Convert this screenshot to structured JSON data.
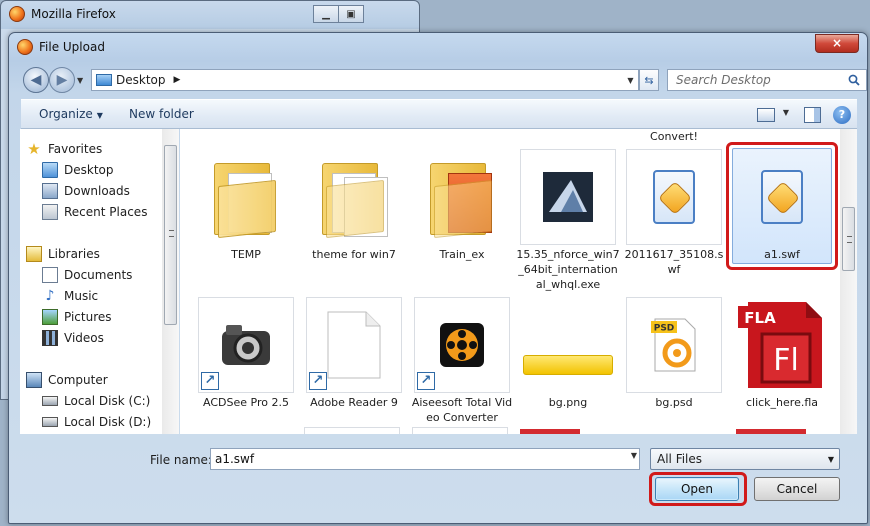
{
  "background_window": {
    "title": "Mozilla Firefox",
    "controls": [
      "minimize-icon",
      "restore-icon"
    ]
  },
  "dialog": {
    "title": "File Upload",
    "close_label": "×"
  },
  "address_bar": {
    "location": "Desktop",
    "separator": "▶",
    "search_placeholder": "Search Desktop"
  },
  "toolbar": {
    "organize_label": "Organize",
    "new_folder_label": "New folder",
    "help_label": "?"
  },
  "nav_pane": {
    "favorites_header": "Favorites",
    "favorites": [
      "Desktop",
      "Downloads",
      "Recent Places"
    ],
    "libraries_header": "Libraries",
    "libraries": [
      "Documents",
      "Music",
      "Pictures",
      "Videos"
    ],
    "computer_header": "Computer",
    "drives": [
      "Local Disk (C:)",
      "Local Disk (D:)"
    ]
  },
  "files": [
    {
      "name": "TEMP",
      "icon": "folder-icon"
    },
    {
      "name": "theme  for win7",
      "icon": "folder-icon"
    },
    {
      "name": "Train_ex",
      "icon": "folder-icon"
    },
    {
      "name": "15.35_nforce_win7_64bit_international_whql.exe",
      "icon": "installer-icon"
    },
    {
      "name": "2011617_35108.swf",
      "caption_above": "Convert!",
      "icon": "swf-icon"
    },
    {
      "name": "a1.swf",
      "icon": "swf-icon",
      "selected": true
    },
    {
      "name": "ACDSee Pro 2.5",
      "icon": "camera-icon",
      "shortcut": true
    },
    {
      "name": "Adobe Reader 9",
      "icon": "blank-document-icon",
      "shortcut": true
    },
    {
      "name": "Aiseesoft Total Video Converter",
      "icon": "film-reel-icon",
      "shortcut": true
    },
    {
      "name": "bg.png",
      "icon": "image-icon"
    },
    {
      "name": "bg.psd",
      "icon": "psd-icon",
      "badge": "PSD"
    },
    {
      "name": "click_here.fla",
      "icon": "fla-icon",
      "badge": "FLA",
      "glyph": "Fl"
    }
  ],
  "footer": {
    "file_name_label": "File name:",
    "file_name_value": "a1.swf",
    "filter_value": "All Files",
    "open_label": "Open",
    "cancel_label": "Cancel"
  },
  "accent_colors": {
    "highlight_ring": "#d11a1a",
    "selection": "#d2e5fb"
  }
}
